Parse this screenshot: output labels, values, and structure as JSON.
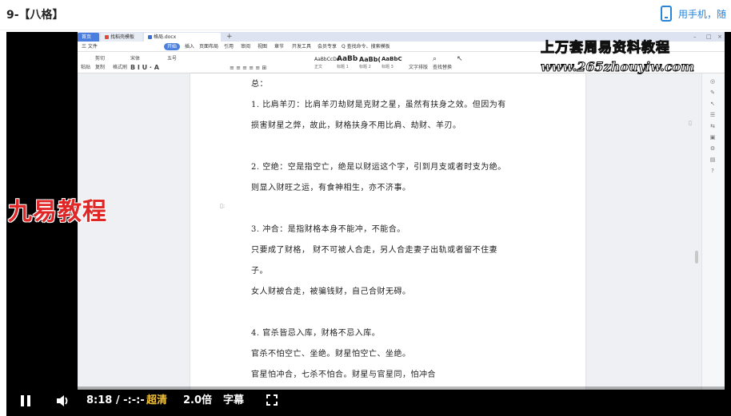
{
  "page": {
    "title": "9-【八格】",
    "phone_link": "用手机，随"
  },
  "wps": {
    "tabs": [
      {
        "label": "首页"
      },
      {
        "label": "找稻壳模板"
      },
      {
        "label": "格局.docx"
      }
    ],
    "menu": [
      "三 文件",
      "开始",
      "插入",
      "页面布局",
      "引用",
      "审阅",
      "视图",
      "章节",
      "开发工具",
      "会员专享",
      "Q 查找命令、搜索模板"
    ],
    "active_menu": "开始",
    "ribbon": {
      "paste": "粘贴",
      "cut": "剪切",
      "copy": "复制",
      "format_painter": "格式刷",
      "font": "宋体",
      "font_size": "五号",
      "text_tool": "文字排版",
      "find_replace": "查找替换",
      "styles": [
        {
          "sample": "AaBbCcDd",
          "label": "正文"
        },
        {
          "sample": "AaBb",
          "label": "标题 1"
        },
        {
          "sample": "AaBb(",
          "label": "标题 2"
        },
        {
          "sample": "AaBbC",
          "label": "标题 3"
        }
      ]
    },
    "document_lines": [
      "总：",
      "1. 比肩羊刃：比肩羊刃劫财是克财之星，虽然有扶身之效。但因为有",
      "损害财星之弊，故此，财格扶身不用比肩、劫财、羊刃。",
      "2. 空绝：空是指空亡，绝是以财运这个字，引到月支或者时支为绝。",
      "则显入财旺之运，有食神相生，亦不济事。",
      "3. 冲合：是指财格本身不能冲，不能合。",
      "只要成了财格，  财不可被人合走，另人合走妻子出轨或者留不住妻",
      "子。",
      "女人财被合走，被骗钱财，自己合财无碍。",
      "4. 官杀皆忌入库，财格不忌入库。",
      "官杀不怕空亡、坐绝。财星怕空亡、坐绝。",
      "官星怕冲合，七杀不怕合。财星与官星同，怕冲合"
    ]
  },
  "watermarks": {
    "top_line1": "上万套周易资料教程",
    "top_line2": "www.265zhouyiw.com",
    "left": "九易教程"
  },
  "controls": {
    "time": "8:18 / -:-:-",
    "quality": "超清",
    "speed": "2.0倍",
    "subtitle": "字幕"
  }
}
